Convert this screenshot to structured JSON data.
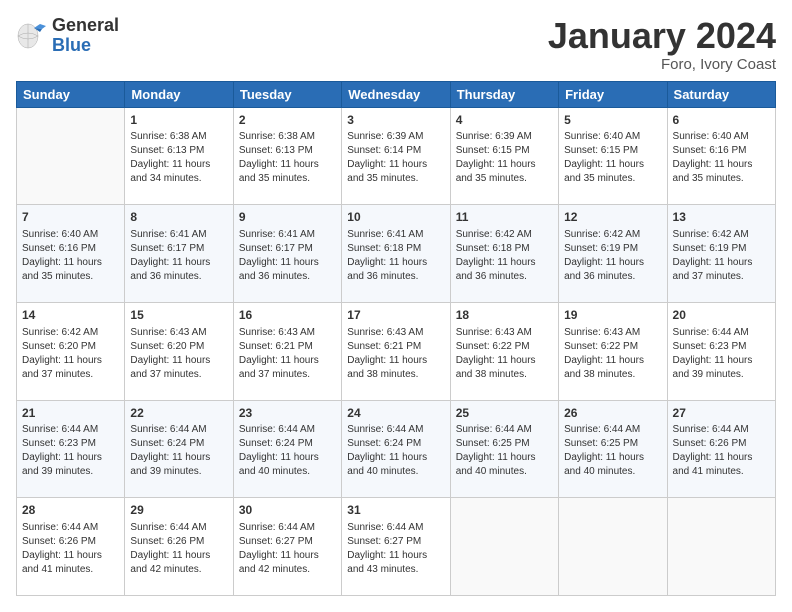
{
  "header": {
    "logo_general": "General",
    "logo_blue": "Blue",
    "title": "January 2024",
    "subtitle": "Foro, Ivory Coast"
  },
  "weekdays": [
    "Sunday",
    "Monday",
    "Tuesday",
    "Wednesday",
    "Thursday",
    "Friday",
    "Saturday"
  ],
  "weeks": [
    [
      {
        "day": "",
        "sunrise": "",
        "sunset": "",
        "daylight": ""
      },
      {
        "day": "1",
        "sunrise": "Sunrise: 6:38 AM",
        "sunset": "Sunset: 6:13 PM",
        "daylight": "Daylight: 11 hours and 34 minutes."
      },
      {
        "day": "2",
        "sunrise": "Sunrise: 6:38 AM",
        "sunset": "Sunset: 6:13 PM",
        "daylight": "Daylight: 11 hours and 35 minutes."
      },
      {
        "day": "3",
        "sunrise": "Sunrise: 6:39 AM",
        "sunset": "Sunset: 6:14 PM",
        "daylight": "Daylight: 11 hours and 35 minutes."
      },
      {
        "day": "4",
        "sunrise": "Sunrise: 6:39 AM",
        "sunset": "Sunset: 6:15 PM",
        "daylight": "Daylight: 11 hours and 35 minutes."
      },
      {
        "day": "5",
        "sunrise": "Sunrise: 6:40 AM",
        "sunset": "Sunset: 6:15 PM",
        "daylight": "Daylight: 11 hours and 35 minutes."
      },
      {
        "day": "6",
        "sunrise": "Sunrise: 6:40 AM",
        "sunset": "Sunset: 6:16 PM",
        "daylight": "Daylight: 11 hours and 35 minutes."
      }
    ],
    [
      {
        "day": "7",
        "sunrise": "Sunrise: 6:40 AM",
        "sunset": "Sunset: 6:16 PM",
        "daylight": "Daylight: 11 hours and 35 minutes."
      },
      {
        "day": "8",
        "sunrise": "Sunrise: 6:41 AM",
        "sunset": "Sunset: 6:17 PM",
        "daylight": "Daylight: 11 hours and 36 minutes."
      },
      {
        "day": "9",
        "sunrise": "Sunrise: 6:41 AM",
        "sunset": "Sunset: 6:17 PM",
        "daylight": "Daylight: 11 hours and 36 minutes."
      },
      {
        "day": "10",
        "sunrise": "Sunrise: 6:41 AM",
        "sunset": "Sunset: 6:18 PM",
        "daylight": "Daylight: 11 hours and 36 minutes."
      },
      {
        "day": "11",
        "sunrise": "Sunrise: 6:42 AM",
        "sunset": "Sunset: 6:18 PM",
        "daylight": "Daylight: 11 hours and 36 minutes."
      },
      {
        "day": "12",
        "sunrise": "Sunrise: 6:42 AM",
        "sunset": "Sunset: 6:19 PM",
        "daylight": "Daylight: 11 hours and 36 minutes."
      },
      {
        "day": "13",
        "sunrise": "Sunrise: 6:42 AM",
        "sunset": "Sunset: 6:19 PM",
        "daylight": "Daylight: 11 hours and 37 minutes."
      }
    ],
    [
      {
        "day": "14",
        "sunrise": "Sunrise: 6:42 AM",
        "sunset": "Sunset: 6:20 PM",
        "daylight": "Daylight: 11 hours and 37 minutes."
      },
      {
        "day": "15",
        "sunrise": "Sunrise: 6:43 AM",
        "sunset": "Sunset: 6:20 PM",
        "daylight": "Daylight: 11 hours and 37 minutes."
      },
      {
        "day": "16",
        "sunrise": "Sunrise: 6:43 AM",
        "sunset": "Sunset: 6:21 PM",
        "daylight": "Daylight: 11 hours and 37 minutes."
      },
      {
        "day": "17",
        "sunrise": "Sunrise: 6:43 AM",
        "sunset": "Sunset: 6:21 PM",
        "daylight": "Daylight: 11 hours and 38 minutes."
      },
      {
        "day": "18",
        "sunrise": "Sunrise: 6:43 AM",
        "sunset": "Sunset: 6:22 PM",
        "daylight": "Daylight: 11 hours and 38 minutes."
      },
      {
        "day": "19",
        "sunrise": "Sunrise: 6:43 AM",
        "sunset": "Sunset: 6:22 PM",
        "daylight": "Daylight: 11 hours and 38 minutes."
      },
      {
        "day": "20",
        "sunrise": "Sunrise: 6:44 AM",
        "sunset": "Sunset: 6:23 PM",
        "daylight": "Daylight: 11 hours and 39 minutes."
      }
    ],
    [
      {
        "day": "21",
        "sunrise": "Sunrise: 6:44 AM",
        "sunset": "Sunset: 6:23 PM",
        "daylight": "Daylight: 11 hours and 39 minutes."
      },
      {
        "day": "22",
        "sunrise": "Sunrise: 6:44 AM",
        "sunset": "Sunset: 6:24 PM",
        "daylight": "Daylight: 11 hours and 39 minutes."
      },
      {
        "day": "23",
        "sunrise": "Sunrise: 6:44 AM",
        "sunset": "Sunset: 6:24 PM",
        "daylight": "Daylight: 11 hours and 40 minutes."
      },
      {
        "day": "24",
        "sunrise": "Sunrise: 6:44 AM",
        "sunset": "Sunset: 6:24 PM",
        "daylight": "Daylight: 11 hours and 40 minutes."
      },
      {
        "day": "25",
        "sunrise": "Sunrise: 6:44 AM",
        "sunset": "Sunset: 6:25 PM",
        "daylight": "Daylight: 11 hours and 40 minutes."
      },
      {
        "day": "26",
        "sunrise": "Sunrise: 6:44 AM",
        "sunset": "Sunset: 6:25 PM",
        "daylight": "Daylight: 11 hours and 40 minutes."
      },
      {
        "day": "27",
        "sunrise": "Sunrise: 6:44 AM",
        "sunset": "Sunset: 6:26 PM",
        "daylight": "Daylight: 11 hours and 41 minutes."
      }
    ],
    [
      {
        "day": "28",
        "sunrise": "Sunrise: 6:44 AM",
        "sunset": "Sunset: 6:26 PM",
        "daylight": "Daylight: 11 hours and 41 minutes."
      },
      {
        "day": "29",
        "sunrise": "Sunrise: 6:44 AM",
        "sunset": "Sunset: 6:26 PM",
        "daylight": "Daylight: 11 hours and 42 minutes."
      },
      {
        "day": "30",
        "sunrise": "Sunrise: 6:44 AM",
        "sunset": "Sunset: 6:27 PM",
        "daylight": "Daylight: 11 hours and 42 minutes."
      },
      {
        "day": "31",
        "sunrise": "Sunrise: 6:44 AM",
        "sunset": "Sunset: 6:27 PM",
        "daylight": "Daylight: 11 hours and 43 minutes."
      },
      {
        "day": "",
        "sunrise": "",
        "sunset": "",
        "daylight": ""
      },
      {
        "day": "",
        "sunrise": "",
        "sunset": "",
        "daylight": ""
      },
      {
        "day": "",
        "sunrise": "",
        "sunset": "",
        "daylight": ""
      }
    ]
  ]
}
